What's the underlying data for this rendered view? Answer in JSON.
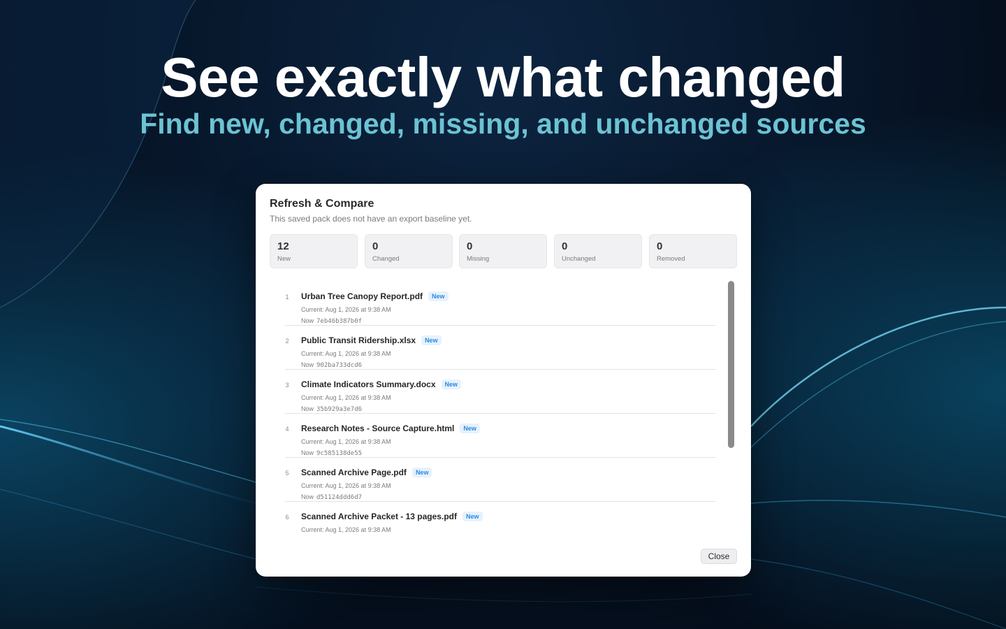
{
  "hero": {
    "title": "See exactly what changed",
    "subtitle": "Find new, changed, missing, and unchanged sources"
  },
  "dialog": {
    "title": "Refresh & Compare",
    "subtitle": "This saved pack does not have an export baseline yet.",
    "stats": [
      {
        "count": "12",
        "label": "New"
      },
      {
        "count": "0",
        "label": "Changed"
      },
      {
        "count": "0",
        "label": "Missing"
      },
      {
        "count": "0",
        "label": "Unchanged"
      },
      {
        "count": "0",
        "label": "Removed"
      }
    ],
    "items": [
      {
        "index": "1",
        "name": "Urban Tree Canopy Report.pdf",
        "badge": "New",
        "current": "Current: Aug 1, 2026 at 9:38 AM",
        "now_label": "Now",
        "hash": "7eb46b387b0f"
      },
      {
        "index": "2",
        "name": "Public Transit Ridership.xlsx",
        "badge": "New",
        "current": "Current: Aug 1, 2026 at 9:38 AM",
        "now_label": "Now",
        "hash": "902ba733dcd6"
      },
      {
        "index": "3",
        "name": "Climate Indicators Summary.docx",
        "badge": "New",
        "current": "Current: Aug 1, 2026 at 9:38 AM",
        "now_label": "Now",
        "hash": "35b929a3e7d6"
      },
      {
        "index": "4",
        "name": "Research Notes - Source Capture.html",
        "badge": "New",
        "current": "Current: Aug 1, 2026 at 9:38 AM",
        "now_label": "Now",
        "hash": "9c585138de55"
      },
      {
        "index": "5",
        "name": "Scanned Archive Page.pdf",
        "badge": "New",
        "current": "Current: Aug 1, 2026 at 9:38 AM",
        "now_label": "Now",
        "hash": "d51124ddd6d7"
      },
      {
        "index": "6",
        "name": "Scanned Archive Packet - 13 pages.pdf",
        "badge": "New",
        "current": "Current: Aug 1, 2026 at 9:38 AM",
        "now_label": "",
        "hash": ""
      }
    ],
    "close_label": "Close"
  },
  "colors": {
    "accent_teal": "#6cc3d3",
    "badge_blue": "#2a8ae0",
    "background": "#081a30"
  }
}
